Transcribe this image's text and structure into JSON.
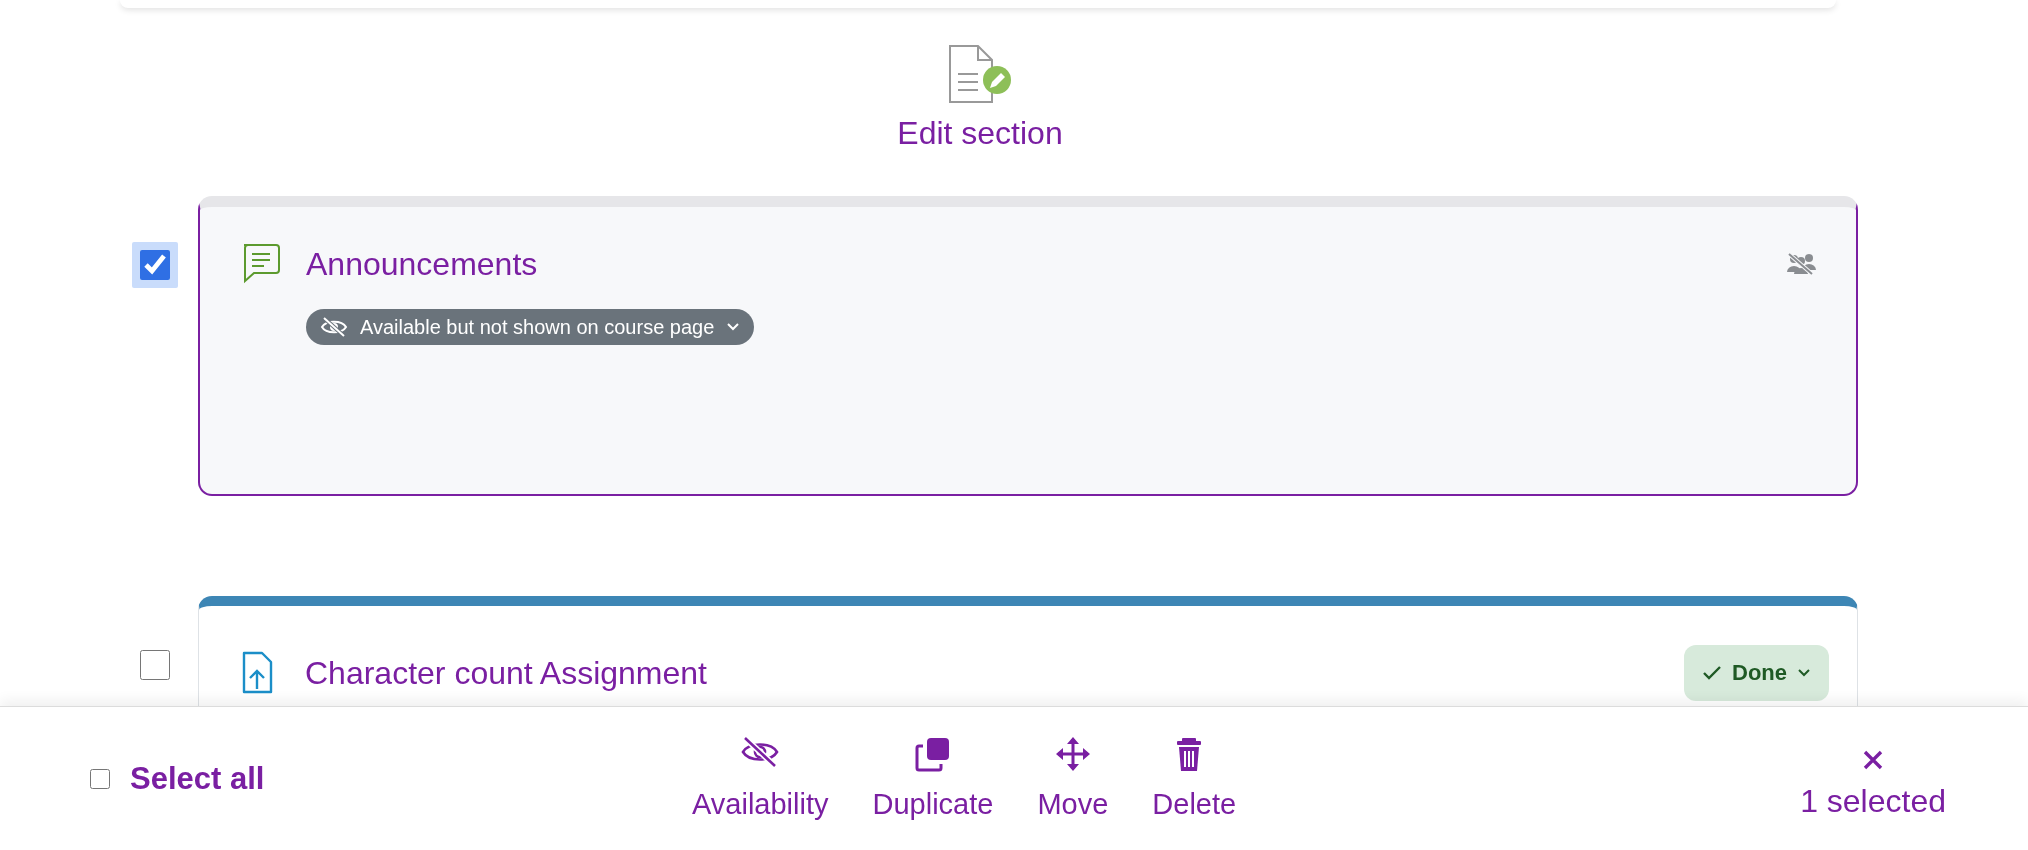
{
  "section_edit": {
    "label": "Edit section"
  },
  "activities": [
    {
      "kind": "forum",
      "title": "Announcements",
      "checked": true,
      "selected": true,
      "availability": "Available but not shown on course page",
      "groups_hidden": true
    },
    {
      "kind": "assignment",
      "title": "Character count Assignment",
      "checked": false,
      "selected": false,
      "completion": "Done"
    }
  ],
  "bulk_bar": {
    "select_all": {
      "label": "Select all",
      "checked": false
    },
    "actions": [
      {
        "kind": "availability",
        "label": "Availability"
      },
      {
        "kind": "duplicate",
        "label": "Duplicate"
      },
      {
        "kind": "move",
        "label": "Move"
      },
      {
        "kind": "delete",
        "label": "Delete"
      }
    ],
    "count": "1 selected"
  }
}
